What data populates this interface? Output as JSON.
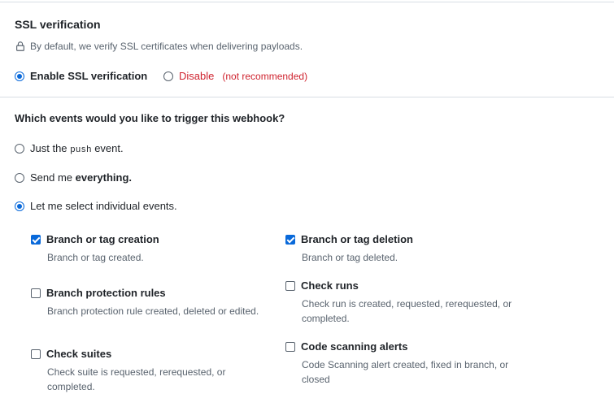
{
  "ssl": {
    "title": "SSL verification",
    "note": "By default, we verify SSL certificates when delivering payloads.",
    "options": {
      "enable_label": "Enable SSL verification",
      "disable_label": "Disable",
      "disable_hint": "(not recommended)"
    }
  },
  "events": {
    "question": "Which events would you like to trigger this webhook?",
    "options": {
      "push_prefix": "Just the",
      "push_code": "push",
      "push_suffix": "event.",
      "everything_prefix": "Send me",
      "everything_bold": "everything.",
      "individual_label": "Let me select individual events."
    },
    "list": [
      {
        "label": "Branch or tag creation",
        "desc": "Branch or tag created.",
        "checked": true
      },
      {
        "label": "Branch or tag deletion",
        "desc": "Branch or tag deleted.",
        "checked": true
      },
      {
        "label": "Branch protection rules",
        "desc": "Branch protection rule created, deleted or edited.",
        "checked": false
      },
      {
        "label": "Check runs",
        "desc": "Check run is created, requested, rerequested, or completed.",
        "checked": false
      },
      {
        "label": "Check suites",
        "desc": "Check suite is requested, rerequested, or completed.",
        "checked": false
      },
      {
        "label": "Code scanning alerts",
        "desc": "Code Scanning alert created, fixed in branch, or closed",
        "checked": false
      }
    ]
  },
  "colors": {
    "accent": "#0969da",
    "danger": "#cf222e",
    "muted": "#59636e"
  }
}
